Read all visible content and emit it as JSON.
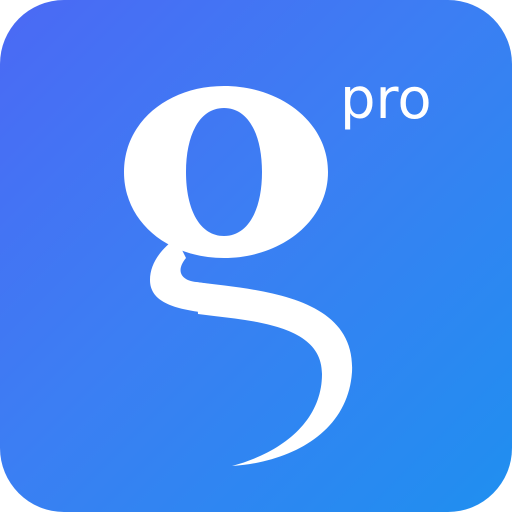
{
  "app_icon": {
    "glyph_icon": "letter-g-icon",
    "suffix_label": "pro",
    "colors": {
      "gradient_start": "#4b69f4",
      "gradient_end": "#1f8ff0",
      "foreground": "#ffffff"
    }
  }
}
